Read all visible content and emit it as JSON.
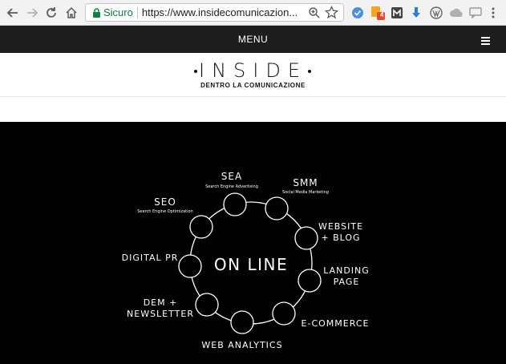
{
  "browser": {
    "secure_label": "Sicuro",
    "url": "https://www.insidecomunicazion...",
    "icons": [
      "back-arrow-icon",
      "forward-arrow-icon",
      "reload-icon",
      "home-icon",
      "lock-icon",
      "zoom-icon",
      "star-icon"
    ],
    "extension_badge": "4"
  },
  "site": {
    "menu_label": "MENU",
    "logo_word": "INSIDE",
    "logo_tagline": "DENTRO LA COMUNICAZIONE"
  },
  "diagram": {
    "center_label": "ON LINE",
    "nodes": [
      {
        "label": "SEA",
        "sublabel": "Search Engine Advertising"
      },
      {
        "label": "SMM",
        "sublabel": "Social Media Marketing"
      },
      {
        "label": "WEBSITE",
        "label2": "+ BLOG"
      },
      {
        "label": "LANDING",
        "label2": "PAGE"
      },
      {
        "label": "E-COMMERCE"
      },
      {
        "label": "WEB ANALYTICS"
      },
      {
        "label": "DEM +",
        "label2": "NEWSLETTER"
      },
      {
        "label": "DIGITAL PR"
      },
      {
        "label": "SEO",
        "sublabel": "Search Engine Optimization"
      }
    ],
    "colors": {
      "background": "#000000",
      "stroke": "#ffffff"
    }
  }
}
